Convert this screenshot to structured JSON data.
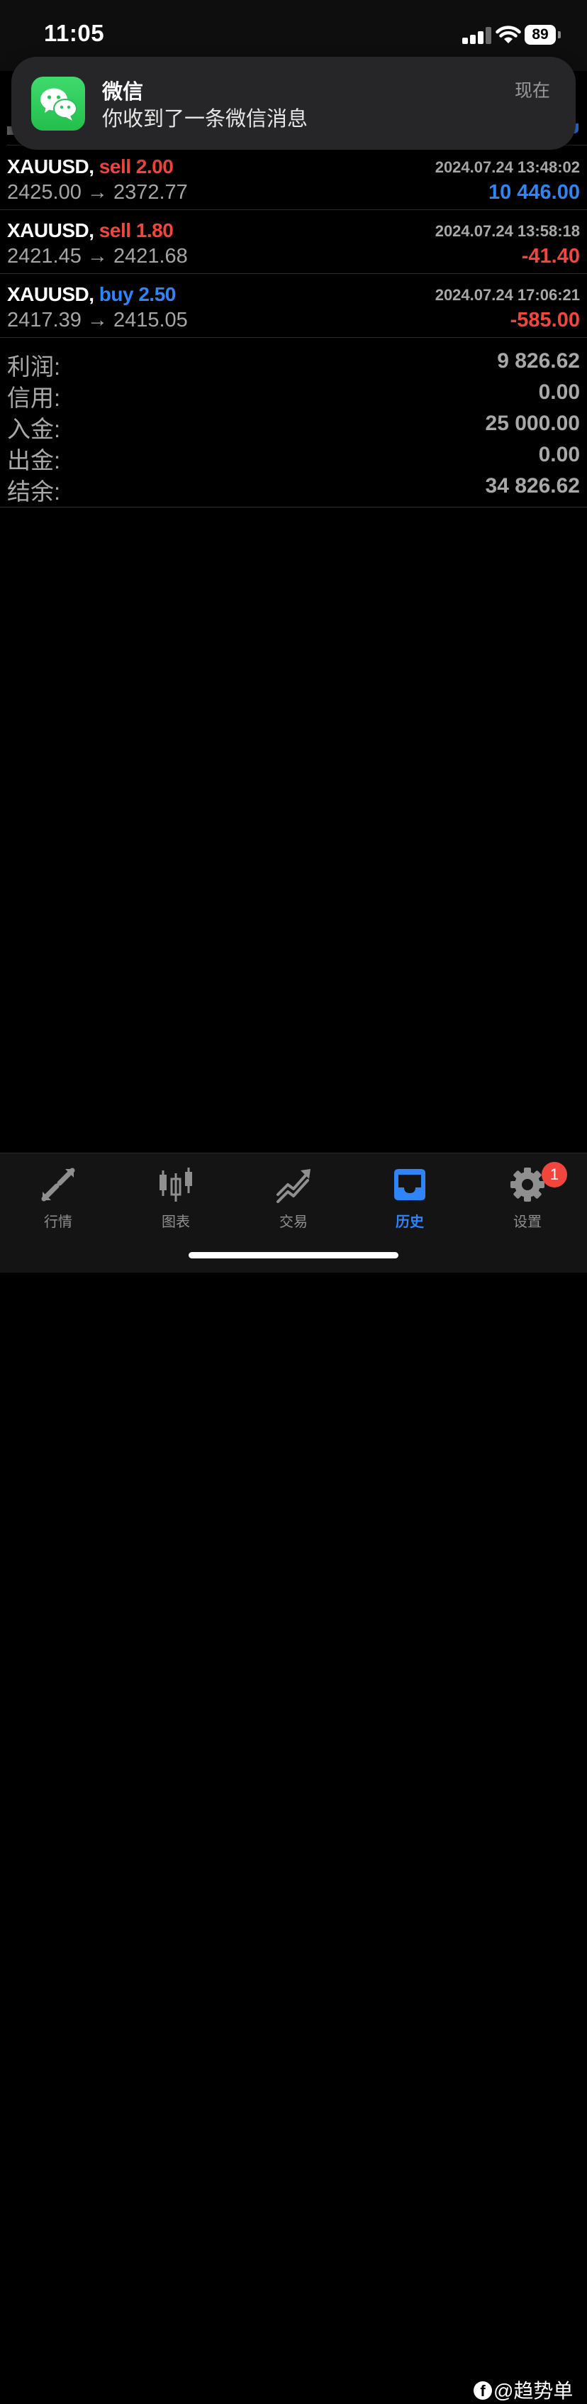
{
  "status_bar": {
    "time": "11:05",
    "battery": "89"
  },
  "notification": {
    "app": "微信",
    "message": "你收到了一条微信消息",
    "time": "现在"
  },
  "trades": [
    {
      "symbol": "XAUUSD,",
      "side": "sell",
      "volume": "2.00",
      "side_label": "sell 2.00",
      "timestamp": "2024.07.24 13:48:02",
      "prices": "2425.00 → 2372.77",
      "profit": "10 446.00",
      "profit_positive": true
    },
    {
      "symbol": "XAUUSD,",
      "side": "sell",
      "volume": "1.80",
      "side_label": "sell 1.80",
      "timestamp": "2024.07.24 13:58:18",
      "prices": "2421.45 → 2421.68",
      "profit": "-41.40",
      "profit_positive": false
    },
    {
      "symbol": "XAUUSD,",
      "side": "buy",
      "volume": "2.50",
      "side_label": "buy 2.50",
      "timestamp": "2024.07.24 17:06:21",
      "prices": "2417.39 → 2415.05",
      "profit": "-585.00",
      "profit_positive": false
    }
  ],
  "summary": [
    {
      "label": "利润:",
      "value": "9 826.62"
    },
    {
      "label": "信用:",
      "value": "0.00"
    },
    {
      "label": "入金:",
      "value": "25 000.00"
    },
    {
      "label": "出金:",
      "value": "0.00"
    },
    {
      "label": "结余:",
      "value": "34 826.62"
    }
  ],
  "tabs": [
    {
      "label": "行情",
      "icon": "quotes-arrows-icon",
      "active": false
    },
    {
      "label": "图表",
      "icon": "candlestick-icon",
      "active": false
    },
    {
      "label": "交易",
      "icon": "trade-chart-icon",
      "active": false
    },
    {
      "label": "历史",
      "icon": "inbox-history-icon",
      "active": true
    },
    {
      "label": "设置",
      "icon": "gear-icon",
      "active": false,
      "badge": "1"
    }
  ],
  "watermark": {
    "text": "@趋势单",
    "logo": "f"
  },
  "colors": {
    "sell": "#f2453d",
    "buy": "#2f84f7",
    "profit_positive": "#2f84f7",
    "profit_negative": "#f2453d",
    "active_tab": "#2f84f7"
  }
}
